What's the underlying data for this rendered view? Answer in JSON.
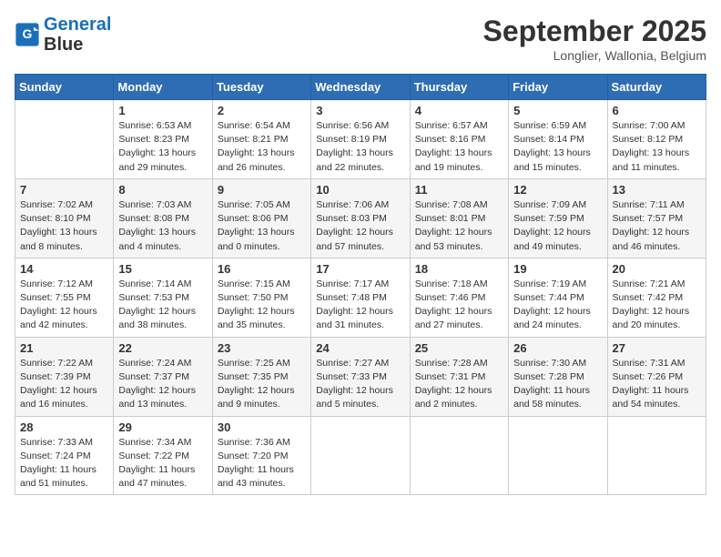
{
  "header": {
    "logo_line1": "General",
    "logo_line2": "Blue",
    "month": "September 2025",
    "location": "Longlier, Wallonia, Belgium"
  },
  "weekdays": [
    "Sunday",
    "Monday",
    "Tuesday",
    "Wednesday",
    "Thursday",
    "Friday",
    "Saturday"
  ],
  "weeks": [
    [
      {
        "day": "",
        "info": ""
      },
      {
        "day": "1",
        "info": "Sunrise: 6:53 AM\nSunset: 8:23 PM\nDaylight: 13 hours\nand 29 minutes."
      },
      {
        "day": "2",
        "info": "Sunrise: 6:54 AM\nSunset: 8:21 PM\nDaylight: 13 hours\nand 26 minutes."
      },
      {
        "day": "3",
        "info": "Sunrise: 6:56 AM\nSunset: 8:19 PM\nDaylight: 13 hours\nand 22 minutes."
      },
      {
        "day": "4",
        "info": "Sunrise: 6:57 AM\nSunset: 8:16 PM\nDaylight: 13 hours\nand 19 minutes."
      },
      {
        "day": "5",
        "info": "Sunrise: 6:59 AM\nSunset: 8:14 PM\nDaylight: 13 hours\nand 15 minutes."
      },
      {
        "day": "6",
        "info": "Sunrise: 7:00 AM\nSunset: 8:12 PM\nDaylight: 13 hours\nand 11 minutes."
      }
    ],
    [
      {
        "day": "7",
        "info": "Sunrise: 7:02 AM\nSunset: 8:10 PM\nDaylight: 13 hours\nand 8 minutes."
      },
      {
        "day": "8",
        "info": "Sunrise: 7:03 AM\nSunset: 8:08 PM\nDaylight: 13 hours\nand 4 minutes."
      },
      {
        "day": "9",
        "info": "Sunrise: 7:05 AM\nSunset: 8:06 PM\nDaylight: 13 hours\nand 0 minutes."
      },
      {
        "day": "10",
        "info": "Sunrise: 7:06 AM\nSunset: 8:03 PM\nDaylight: 12 hours\nand 57 minutes."
      },
      {
        "day": "11",
        "info": "Sunrise: 7:08 AM\nSunset: 8:01 PM\nDaylight: 12 hours\nand 53 minutes."
      },
      {
        "day": "12",
        "info": "Sunrise: 7:09 AM\nSunset: 7:59 PM\nDaylight: 12 hours\nand 49 minutes."
      },
      {
        "day": "13",
        "info": "Sunrise: 7:11 AM\nSunset: 7:57 PM\nDaylight: 12 hours\nand 46 minutes."
      }
    ],
    [
      {
        "day": "14",
        "info": "Sunrise: 7:12 AM\nSunset: 7:55 PM\nDaylight: 12 hours\nand 42 minutes."
      },
      {
        "day": "15",
        "info": "Sunrise: 7:14 AM\nSunset: 7:53 PM\nDaylight: 12 hours\nand 38 minutes."
      },
      {
        "day": "16",
        "info": "Sunrise: 7:15 AM\nSunset: 7:50 PM\nDaylight: 12 hours\nand 35 minutes."
      },
      {
        "day": "17",
        "info": "Sunrise: 7:17 AM\nSunset: 7:48 PM\nDaylight: 12 hours\nand 31 minutes."
      },
      {
        "day": "18",
        "info": "Sunrise: 7:18 AM\nSunset: 7:46 PM\nDaylight: 12 hours\nand 27 minutes."
      },
      {
        "day": "19",
        "info": "Sunrise: 7:19 AM\nSunset: 7:44 PM\nDaylight: 12 hours\nand 24 minutes."
      },
      {
        "day": "20",
        "info": "Sunrise: 7:21 AM\nSunset: 7:42 PM\nDaylight: 12 hours\nand 20 minutes."
      }
    ],
    [
      {
        "day": "21",
        "info": "Sunrise: 7:22 AM\nSunset: 7:39 PM\nDaylight: 12 hours\nand 16 minutes."
      },
      {
        "day": "22",
        "info": "Sunrise: 7:24 AM\nSunset: 7:37 PM\nDaylight: 12 hours\nand 13 minutes."
      },
      {
        "day": "23",
        "info": "Sunrise: 7:25 AM\nSunset: 7:35 PM\nDaylight: 12 hours\nand 9 minutes."
      },
      {
        "day": "24",
        "info": "Sunrise: 7:27 AM\nSunset: 7:33 PM\nDaylight: 12 hours\nand 5 minutes."
      },
      {
        "day": "25",
        "info": "Sunrise: 7:28 AM\nSunset: 7:31 PM\nDaylight: 12 hours\nand 2 minutes."
      },
      {
        "day": "26",
        "info": "Sunrise: 7:30 AM\nSunset: 7:28 PM\nDaylight: 11 hours\nand 58 minutes."
      },
      {
        "day": "27",
        "info": "Sunrise: 7:31 AM\nSunset: 7:26 PM\nDaylight: 11 hours\nand 54 minutes."
      }
    ],
    [
      {
        "day": "28",
        "info": "Sunrise: 7:33 AM\nSunset: 7:24 PM\nDaylight: 11 hours\nand 51 minutes."
      },
      {
        "day": "29",
        "info": "Sunrise: 7:34 AM\nSunset: 7:22 PM\nDaylight: 11 hours\nand 47 minutes."
      },
      {
        "day": "30",
        "info": "Sunrise: 7:36 AM\nSunset: 7:20 PM\nDaylight: 11 hours\nand 43 minutes."
      },
      {
        "day": "",
        "info": ""
      },
      {
        "day": "",
        "info": ""
      },
      {
        "day": "",
        "info": ""
      },
      {
        "day": "",
        "info": ""
      }
    ]
  ]
}
